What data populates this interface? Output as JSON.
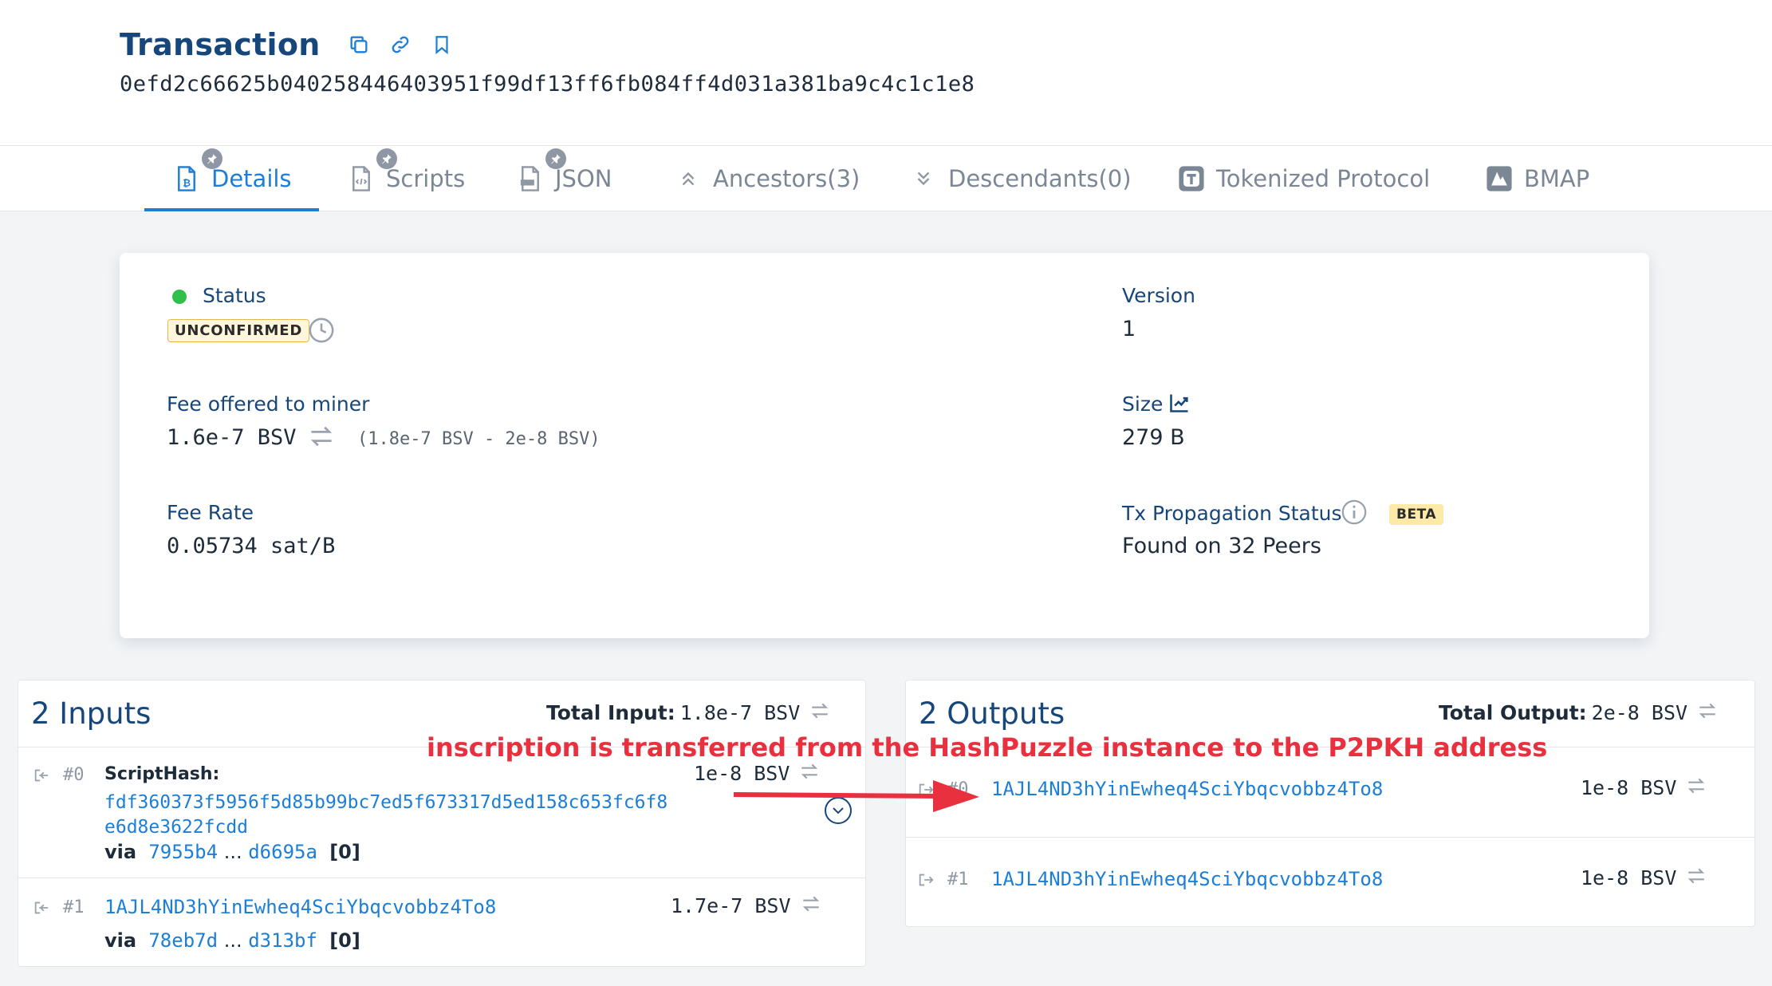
{
  "header": {
    "title": "Transaction",
    "txid": "0efd2c66625b040258446403951f99df13ff6fb084ff4d031a381ba9c4c1c1e8",
    "icons": [
      "copy-icon",
      "link-icon",
      "bookmark-icon"
    ]
  },
  "tabs": [
    {
      "label": "Details",
      "icon": "bitcoin-doc-icon",
      "active": true,
      "pinned": true
    },
    {
      "label": "Scripts",
      "icon": "code-doc-icon",
      "active": false,
      "pinned": true
    },
    {
      "label": "JSON",
      "icon": "json-doc-icon",
      "active": false,
      "pinned": true
    },
    {
      "label": "Ancestors(3)",
      "icon": "chevrons-up-icon",
      "active": false
    },
    {
      "label": "Descendants(0)",
      "icon": "chevrons-down-icon",
      "active": false
    },
    {
      "label": "Tokenized Protocol",
      "icon": "tokenized-icon",
      "active": false
    },
    {
      "label": "BMAP",
      "icon": "bmap-icon",
      "active": false
    }
  ],
  "details": {
    "status_label": "Status",
    "status_badge": "UNCONFIRMED",
    "status_color": "#2fbf4a",
    "version_label": "Version",
    "version_value": "1",
    "fee_label": "Fee offered to miner",
    "fee_value": "1.6e-7 BSV",
    "fee_range": "(1.8e-7 BSV - 2e-8 BSV)",
    "size_label": "Size",
    "size_value": "279 B",
    "feerate_label": "Fee Rate",
    "feerate_value": "0.05734 sat/B",
    "propagation_label": "Tx Propagation Status",
    "propagation_badge": "BETA",
    "propagation_value": "Found on 32 Peers"
  },
  "inputs": {
    "title": "2 Inputs",
    "total_label": "Total Input:",
    "total_value": "1.8e-7 BSV",
    "items": [
      {
        "index": "#0",
        "type_label": "ScriptHash:",
        "hash": "fdf360373f5956f5d85b99bc7ed5f673317d5ed158c653fc6f8e6d8e3622fcdd",
        "amount": "1e-8 BSV",
        "via_label": "via",
        "via_start": "7955b4",
        "via_sep": "...",
        "via_end": "d6695a",
        "via_index": "[0]"
      },
      {
        "index": "#1",
        "address": "1AJL4ND3hYinEwheq4SciYbqcvobbz4To8",
        "amount": "1.7e-7 BSV",
        "via_label": "via",
        "via_start": "78eb7d",
        "via_sep": "...",
        "via_end": "d313bf",
        "via_index": "[0]"
      }
    ]
  },
  "outputs": {
    "title": "2 Outputs",
    "total_label": "Total Output:",
    "total_value": "2e-8 BSV",
    "items": [
      {
        "index": "#0",
        "address": "1AJL4ND3hYinEwheq4SciYbqcvobbz4To8",
        "amount": "1e-8 BSV"
      },
      {
        "index": "#1",
        "address": "1AJL4ND3hYinEwheq4SciYbqcvobbz4To8",
        "amount": "1e-8 BSV"
      }
    ]
  },
  "annotation": {
    "text": "inscription is transferred from the HashPuzzle instance to the P2PKH address",
    "color": "#e8303f"
  },
  "colors": {
    "primary_dark": "#16467a",
    "link": "#1c7ed6",
    "muted": "#7b8795"
  }
}
